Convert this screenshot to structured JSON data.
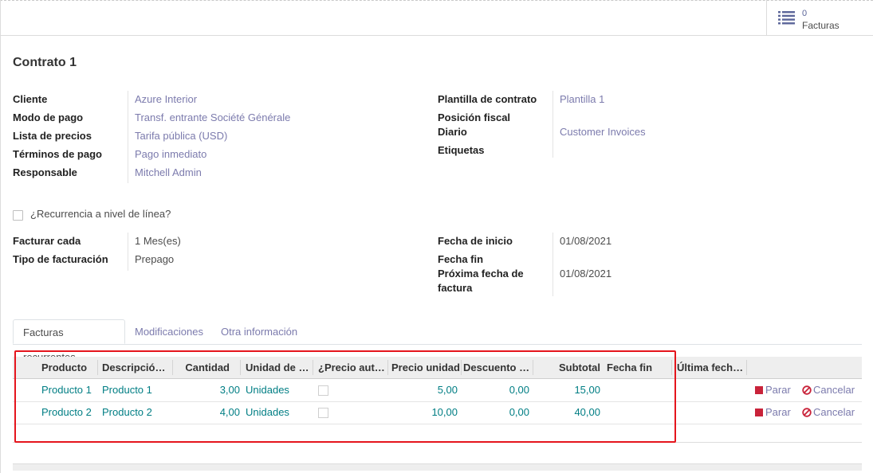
{
  "stat_button": {
    "value": "0",
    "label": "Facturas",
    "icon": "list-icon"
  },
  "title": "Contrato 1",
  "left_fields": [
    {
      "label": "Cliente",
      "value": "Azure Interior"
    },
    {
      "label": "Modo de pago",
      "value": "Transf. entrante Société Générale"
    },
    {
      "label": "Lista de precios",
      "value": "Tarifa pública (USD)"
    },
    {
      "label": "Términos de pago",
      "value": "Pago inmediato"
    },
    {
      "label": "Responsable",
      "value": "Mitchell Admin"
    }
  ],
  "right_fields": {
    "template_label": "Plantilla de contrato",
    "template_value": "Plantilla 1",
    "fiscal_label": "Posición fiscal",
    "journal_label": "Diario",
    "journal_value": "Customer Invoices",
    "tags_label": "Etiquetas"
  },
  "recurrence_checkbox": {
    "label": "¿Recurrencia a nivel de línea?",
    "checked": false
  },
  "billing": {
    "every_label": "Facturar cada",
    "every_value": "1 Mes(es)",
    "type_label": "Tipo de facturación",
    "type_value": "Prepago",
    "start_label": "Fecha de inicio",
    "start_value": "01/08/2021",
    "end_label": "Fecha fin",
    "next_label": "Próxima fecha de factura",
    "next_value": "01/08/2021"
  },
  "tabs": [
    "Facturas recurrentes",
    "Modificaciones",
    "Otra información"
  ],
  "table": {
    "headers": [
      "Producto",
      "Descripció…",
      "Cantidad",
      "Unidad de …",
      "¿Precio aut…",
      "Precio unidad",
      "Descuento …",
      "Subtotal",
      "Fecha fin",
      "Última fech…"
    ],
    "rows": [
      {
        "product": "Producto 1",
        "description": "Producto 1",
        "quantity": "3,00",
        "unit": "Unidades",
        "auto_price": false,
        "unit_price": "5,00",
        "discount": "0,00",
        "subtotal": "15,00",
        "end_date": "",
        "last_date": ""
      },
      {
        "product": "Producto 2",
        "description": "Producto 2",
        "quantity": "4,00",
        "unit": "Unidades",
        "auto_price": false,
        "unit_price": "10,00",
        "discount": "0,00",
        "subtotal": "40,00",
        "end_date": "",
        "last_date": ""
      }
    ],
    "actions": {
      "stop": "Parar",
      "cancel": "Cancelar"
    }
  },
  "colors": {
    "link": "#7c7bad",
    "teal": "#017e84",
    "stop": "#c9233a",
    "highlight": "#e5151d"
  }
}
